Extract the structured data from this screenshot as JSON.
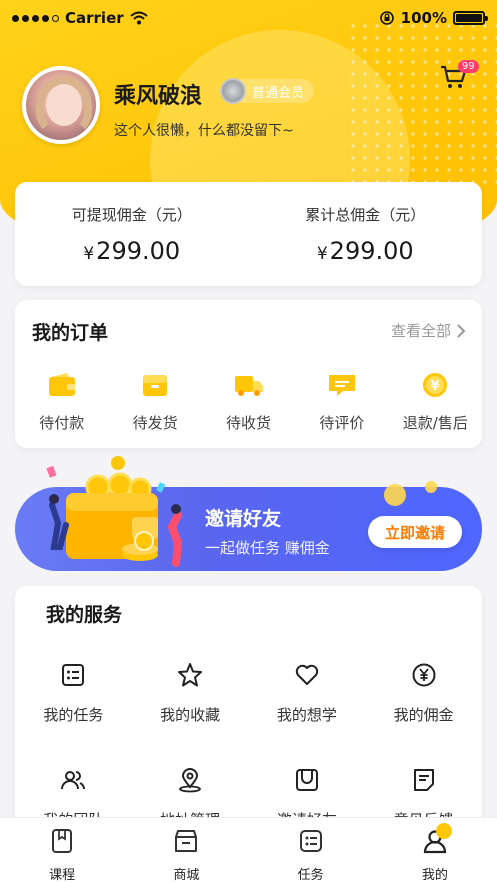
{
  "status_bar": {
    "carrier": "Carrier",
    "battery": "100%"
  },
  "profile": {
    "name": "乘风破浪",
    "member_level": "普通会员",
    "signature": "这个人很懒，什么都没留下~"
  },
  "cart": {
    "badge": "99"
  },
  "commission": {
    "withdrawable_label": "可提现佣金（元）",
    "withdrawable_currency": "¥",
    "withdrawable_value": "299.00",
    "total_label": "累计总佣金（元）",
    "total_currency": "¥",
    "total_value": "299.00"
  },
  "orders": {
    "title": "我的订单",
    "view_all": "查看全部",
    "items": [
      {
        "label": "待付款",
        "icon": "wallet-icon"
      },
      {
        "label": "待发货",
        "icon": "package-icon"
      },
      {
        "label": "待收货",
        "icon": "truck-icon"
      },
      {
        "label": "待评价",
        "icon": "comment-icon"
      },
      {
        "label": "退款/售后",
        "icon": "refund-icon"
      }
    ]
  },
  "banner": {
    "title": "邀请好友",
    "subtitle": "一起做任务 赚佣金",
    "button": "立即邀请"
  },
  "services": {
    "title": "我的服务",
    "items": [
      {
        "label": "我的任务",
        "icon": "task-list-icon"
      },
      {
        "label": "我的收藏",
        "icon": "star-icon"
      },
      {
        "label": "我的想学",
        "icon": "heart-icon"
      },
      {
        "label": "我的佣金",
        "icon": "yen-coin-icon"
      },
      {
        "label": "我的团队",
        "icon": "team-icon"
      },
      {
        "label": "地址管理",
        "icon": "location-icon"
      },
      {
        "label": "邀请好友",
        "icon": "invite-icon"
      },
      {
        "label": "意见反馈",
        "icon": "feedback-icon"
      }
    ]
  },
  "tabbar": {
    "items": [
      {
        "label": "课程",
        "icon": "book-icon"
      },
      {
        "label": "商城",
        "icon": "store-icon"
      },
      {
        "label": "任务",
        "icon": "task-icon"
      },
      {
        "label": "我的",
        "icon": "profile-icon",
        "active": true
      }
    ]
  },
  "colors": {
    "brand_yellow": "#ffc60a",
    "banner_blue": "#5a66ee",
    "invite_orange": "#ff7a00",
    "badge_pink": "#ff3b6a"
  }
}
